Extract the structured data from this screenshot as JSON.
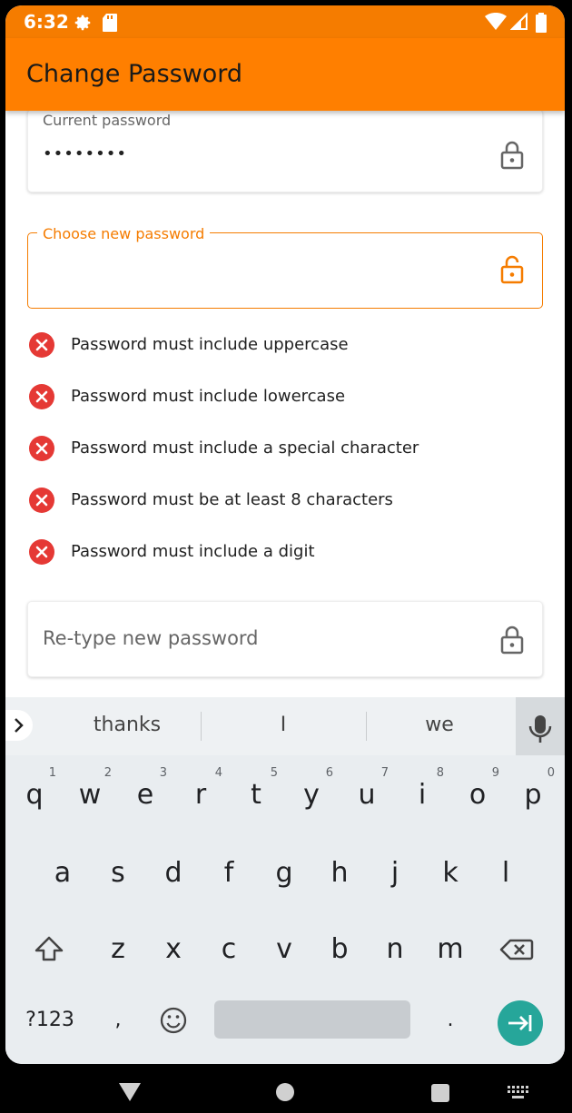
{
  "status_bar": {
    "time": "6:32"
  },
  "app_bar": {
    "title": "Change Password"
  },
  "form": {
    "current_password": {
      "label": "Current password",
      "value": "••••••••"
    },
    "new_password": {
      "label": "Choose new password",
      "value": ""
    },
    "rules": [
      {
        "text": "Password must include uppercase",
        "status": "unmet"
      },
      {
        "text": "Password must include lowercase",
        "status": "unmet"
      },
      {
        "text": "Password must include a special character",
        "status": "unmet"
      },
      {
        "text": "Password must be at least 8 characters",
        "status": "unmet"
      },
      {
        "text": "Password must include a digit",
        "status": "unmet"
      }
    ],
    "retype_password": {
      "placeholder": "Re-type new password"
    }
  },
  "keyboard": {
    "suggestions": [
      "thanks",
      "I",
      "we"
    ],
    "row1": [
      {
        "k": "q",
        "h": "1"
      },
      {
        "k": "w",
        "h": "2"
      },
      {
        "k": "e",
        "h": "3"
      },
      {
        "k": "r",
        "h": "4"
      },
      {
        "k": "t",
        "h": "5"
      },
      {
        "k": "y",
        "h": "6"
      },
      {
        "k": "u",
        "h": "7"
      },
      {
        "k": "i",
        "h": "8"
      },
      {
        "k": "o",
        "h": "9"
      },
      {
        "k": "p",
        "h": "0"
      }
    ],
    "row2": [
      "a",
      "s",
      "d",
      "f",
      "g",
      "h",
      "j",
      "k",
      "l"
    ],
    "row3": [
      "z",
      "x",
      "c",
      "v",
      "b",
      "n",
      "m"
    ],
    "symbols_label": "?123",
    "comma": ",",
    "period": "."
  },
  "colors": {
    "accent": "#ff7f00",
    "error": "#e53935",
    "enter": "#26a69a"
  }
}
